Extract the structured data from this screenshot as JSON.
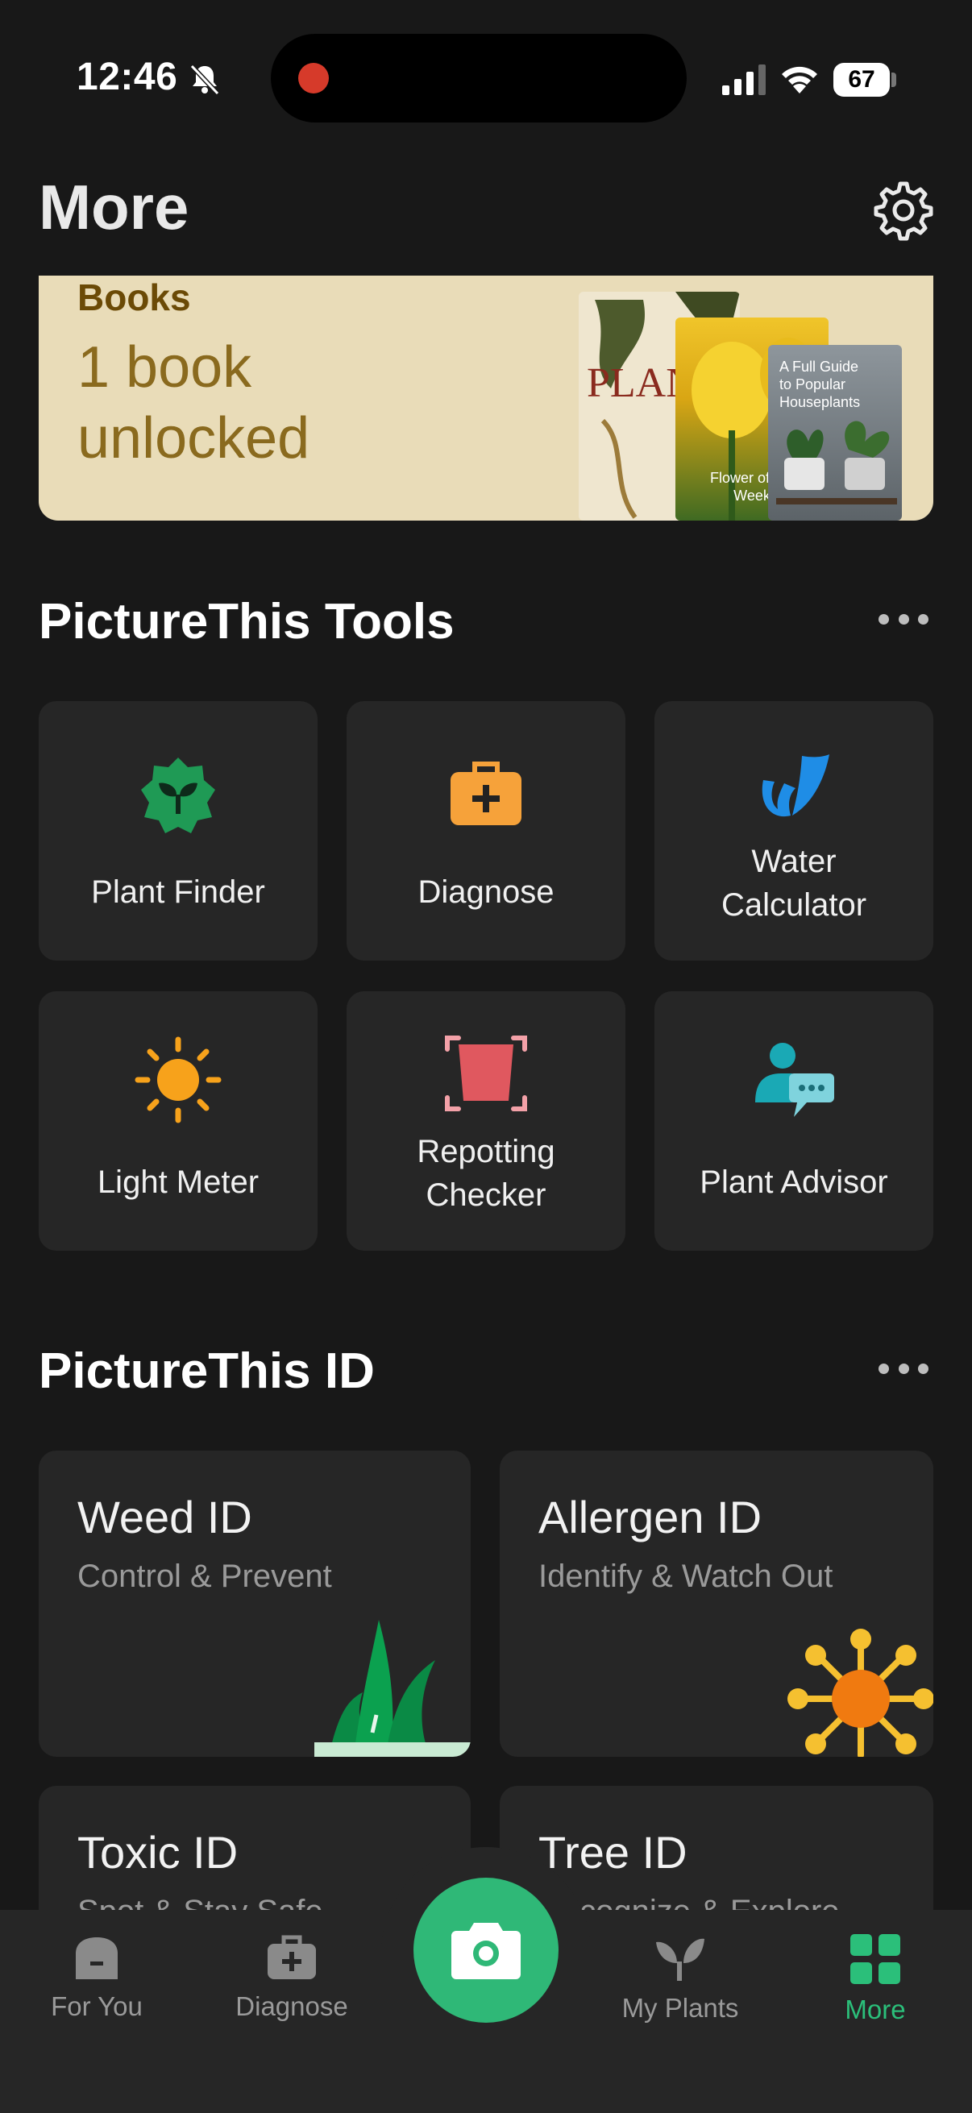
{
  "status_bar": {
    "time": "12:46",
    "battery": "67"
  },
  "header": {
    "title": "More"
  },
  "books": {
    "label": "Books",
    "subtitle": "1 book unlocked",
    "covers": [
      "PLAN",
      "Flower of the Week",
      "A Full Guide to Popular Houseplants"
    ]
  },
  "tools": {
    "title": "PictureThis Tools",
    "items": [
      {
        "label": "Plant Finder",
        "icon": "plant-finder-icon"
      },
      {
        "label": "Diagnose",
        "icon": "diagnose-kit-icon"
      },
      {
        "label": "Water Calculator",
        "icon": "water-calculator-icon"
      },
      {
        "label": "Light Meter",
        "icon": "sun-icon"
      },
      {
        "label": "Repotting Checker",
        "icon": "pot-icon"
      },
      {
        "label": "Plant Advisor",
        "icon": "advisor-chat-icon"
      }
    ]
  },
  "id_section": {
    "title": "PictureThis ID",
    "cards": [
      {
        "title": "Weed ID",
        "subtitle": "Control & Prevent"
      },
      {
        "title": "Allergen ID",
        "subtitle": "Identify & Watch Out"
      },
      {
        "title": "Toxic ID",
        "subtitle": "Spot & Stay Safe"
      },
      {
        "title": "Tree ID",
        "subtitle": "Recognize & Explore"
      }
    ]
  },
  "tabbar": {
    "items": [
      {
        "label": "For You"
      },
      {
        "label": "Diagnose"
      },
      {
        "label": "My Plants"
      },
      {
        "label": "More"
      }
    ],
    "active": "More"
  },
  "colors": {
    "accent": "#2bbf7a",
    "background": "#181818",
    "tile": "#262626"
  }
}
